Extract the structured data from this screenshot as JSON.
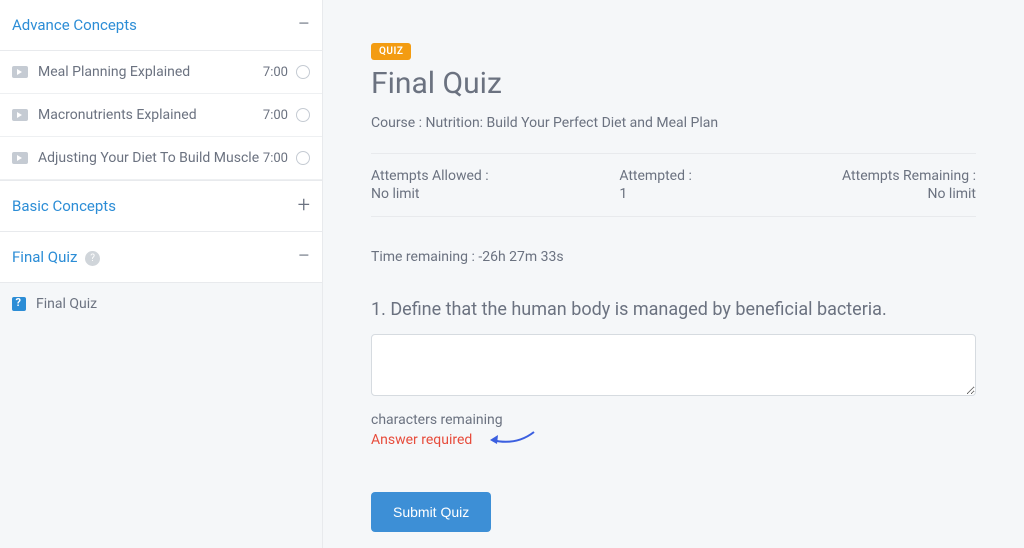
{
  "sidebar": {
    "sections": [
      {
        "title": "Advance Concepts",
        "expanded": true,
        "lessons": [
          {
            "title": "Meal Planning Explained",
            "duration": "7:00"
          },
          {
            "title": "Macronutrients Explained",
            "duration": "7:00"
          },
          {
            "title": "Adjusting Your Diet To Build Muscle",
            "duration": "7:00"
          }
        ]
      },
      {
        "title": "Basic Concepts",
        "expanded": false
      },
      {
        "title": "Final Quiz",
        "expanded": true,
        "quiz_item": "Final Quiz"
      }
    ]
  },
  "main": {
    "badge": "QUIZ",
    "title": "Final Quiz",
    "course_prefix": "Course : ",
    "course_name": "Nutrition: Build Your Perfect Diet and Meal Plan",
    "attempts": {
      "allowed_label": "Attempts Allowed :",
      "allowed_value": "No limit",
      "attempted_label": "Attempted :",
      "attempted_value": "1",
      "remaining_label": "Attempts Remaining :",
      "remaining_value": "No limit"
    },
    "time_remaining_label": "Time remaining : ",
    "time_remaining_value": "-26h 27m 33s",
    "question": {
      "number": "1",
      "text": "Define that the human body is managed by beneficial bacteria.",
      "chars_remaining": "characters remaining",
      "error": "Answer required"
    },
    "submit_label": "Submit Quiz"
  }
}
